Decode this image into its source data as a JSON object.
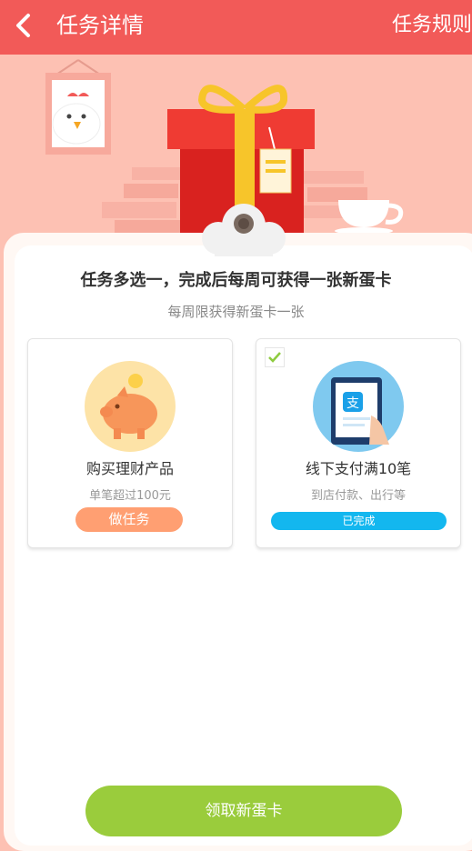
{
  "header": {
    "title": "任务详情",
    "rules_label": "任务规则"
  },
  "main": {
    "title": "任务多选一，完成后每周可获得一张新蛋卡",
    "subtitle": "每周限获得新蛋卡一张",
    "tasks": [
      {
        "name": "购买理财产品",
        "desc": "单笔超过100元",
        "button_label": "做任务",
        "checked": false,
        "icon": "piggy-bank-icon"
      },
      {
        "name": "线下支付满10笔",
        "desc": "到店付款、出行等",
        "button_label": "已完成",
        "checked": true,
        "icon": "alipay-tablet-icon"
      }
    ],
    "claim_button_label": "领取新蛋卡"
  },
  "colors": {
    "header_bg": "#f25a58",
    "hero_bg": "#fdc1b3",
    "do_task_button": "#ff9f72",
    "done_button": "#13b7ef",
    "claim_button": "#9acc3c"
  }
}
